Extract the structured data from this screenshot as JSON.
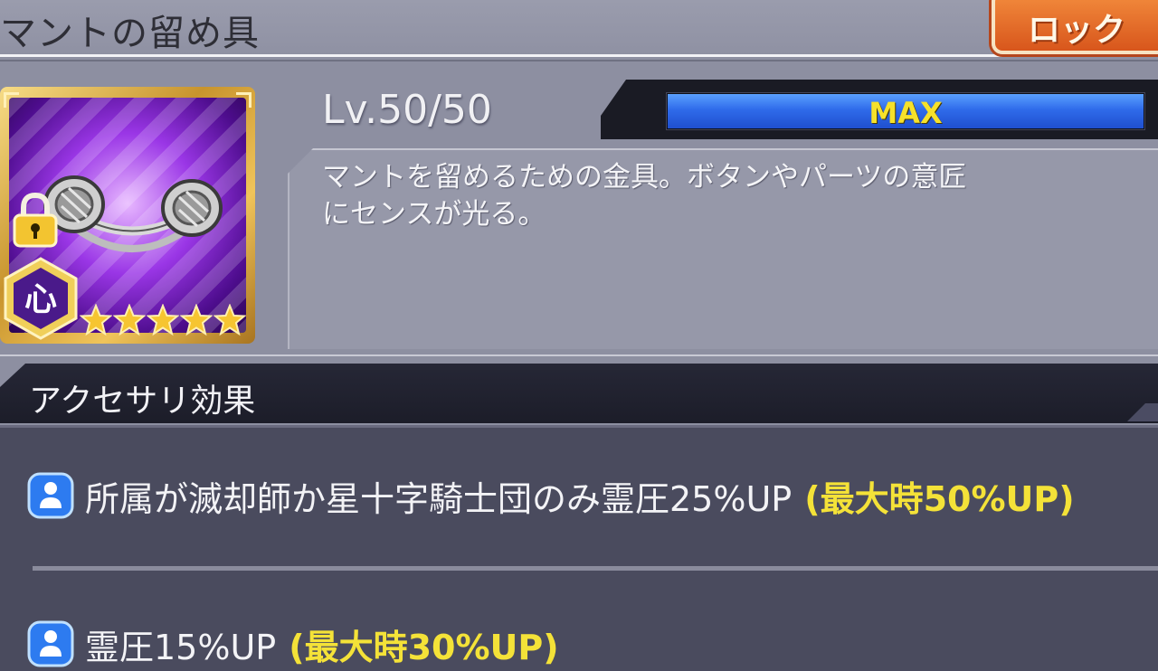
{
  "header": {
    "title": "マントの留め具",
    "lock_button_label": "ロック"
  },
  "item": {
    "icon": "cloak-clasp-icon",
    "element_badge": "心",
    "star_rating": 5,
    "locked": true
  },
  "level": {
    "label": "Lv.50/50",
    "status": "MAX",
    "exp_fill_fraction": 1.0
  },
  "description": "マントを留めるための金具。ボタンやパーツの意匠\nにセンスが光る。",
  "effects": {
    "title": "アクセサリ効果",
    "items": [
      {
        "icon": "person-icon",
        "text": "所属が滅却師か星十字騎士団のみ霊圧25%UP",
        "max_text": "(最大時50%UP)"
      },
      {
        "icon": "person-icon",
        "text": "霊圧15%UP",
        "max_text": "(最大時30%UP)"
      }
    ]
  },
  "colors": {
    "background": "#8d8fa1",
    "lock_button": "#e56d27",
    "exp_bar": "#2f6bea",
    "max_highlight": "#f4e238",
    "effects_panel": "#4a4b5e"
  }
}
